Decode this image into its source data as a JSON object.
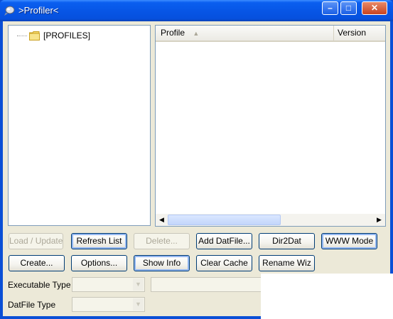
{
  "window": {
    "title": ">Profiler<",
    "min": "–",
    "max": "□",
    "close": "✕"
  },
  "tree": {
    "root_label": "[PROFILES]"
  },
  "list": {
    "columns": [
      "Profile",
      "Version"
    ],
    "sort_indicator": "▲",
    "scroll_left": "◀",
    "scroll_right": "▶"
  },
  "buttons": {
    "load_update": "Load / Update",
    "refresh_list": "Refresh List",
    "delete": "Delete...",
    "add_datfile": "Add DatFile...",
    "dir2dat": "Dir2Dat",
    "www_mode": "WWW Mode",
    "create": "Create...",
    "options": "Options...",
    "show_info": "Show Info",
    "clear_cache": "Clear Cache",
    "rename_wiz": "Rename Wiz"
  },
  "fields": {
    "executable_type_label": "Executable Type",
    "executable_type_value": "",
    "datfile_type_label": "DatFile Type",
    "datfile_type_value": "",
    "path_value": "",
    "dropdown_arrow": "▼"
  },
  "colors": {
    "titlebar": "#0756e6",
    "dialog_bg": "#ece9d8",
    "button_border": "#003c74"
  }
}
